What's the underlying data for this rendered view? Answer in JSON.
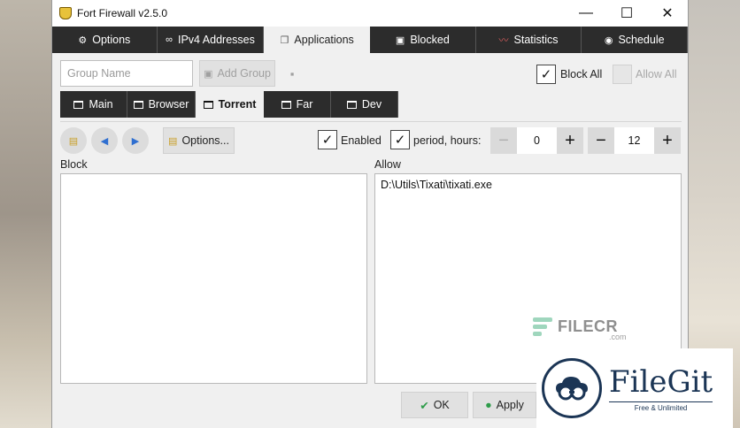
{
  "window": {
    "title": "Fort Firewall v2.5.0",
    "controls": {
      "minimize": "—",
      "maximize": "☐",
      "close": "✕"
    }
  },
  "tabs": [
    {
      "label": "Options",
      "icon": "gear-icon",
      "glyph": "⚙",
      "active": false
    },
    {
      "label": "IPv4 Addresses",
      "icon": "link-icon",
      "glyph": "∞",
      "active": false
    },
    {
      "label": "Applications",
      "icon": "window-icon",
      "glyph": "❐",
      "active": true
    },
    {
      "label": "Blocked",
      "icon": "blocked-icon",
      "glyph": "▣",
      "active": false
    },
    {
      "label": "Statistics",
      "icon": "chart-icon",
      "glyph": "〰",
      "active": false
    },
    {
      "label": "Schedule",
      "icon": "clock-icon",
      "glyph": "◉",
      "active": false
    }
  ],
  "group_bar": {
    "group_name_placeholder": "Group Name",
    "add_group_label": "Add Group",
    "block_all_label": "Block All",
    "block_all_checked": true,
    "allow_all_label": "Allow All",
    "allow_all_checked": false
  },
  "groups": [
    {
      "label": "Main",
      "active": false
    },
    {
      "label": "Browser",
      "active": false
    },
    {
      "label": "Torrent",
      "active": true
    },
    {
      "label": "Far",
      "active": false
    },
    {
      "label": "Dev",
      "active": false
    }
  ],
  "group_options": {
    "options_label": "Options...",
    "enabled_label": "Enabled",
    "enabled_checked": true,
    "period_label": "period, hours:",
    "period_checked": true,
    "period_from": "0",
    "period_to": "12",
    "minus": "−",
    "plus": "+"
  },
  "block": {
    "label": "Block",
    "items": []
  },
  "allow": {
    "label": "Allow",
    "items": [
      "D:\\Utils\\Tixati\\tixati.exe"
    ]
  },
  "footer": {
    "ok_label": "OK",
    "apply_label": "Apply"
  },
  "watermarks": {
    "filecr": "FILECR",
    "filecr_com": ".com",
    "filegit": "FileGit",
    "filegit_tag": "Free & Unlimited"
  },
  "colors": {
    "tab_bg": "#2c2c2c",
    "accent_blue": "#2f6fd0",
    "filegit_navy": "#1b3555"
  }
}
